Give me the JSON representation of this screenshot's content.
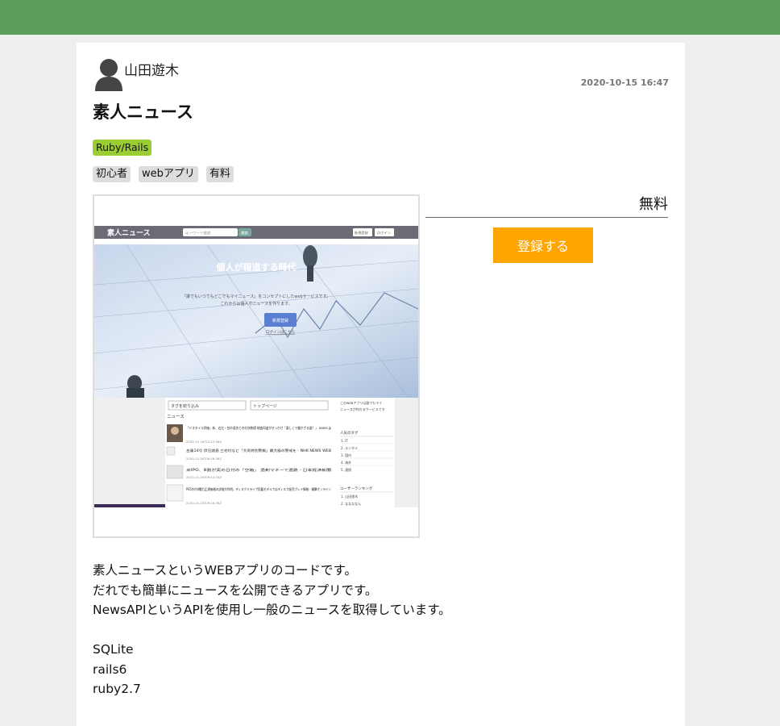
{
  "post": {
    "author": "山田遊木",
    "date": "2020-10-15 16:47",
    "title": "素人ニュース",
    "category": "Ruby/Rails",
    "tags": [
      "初心者",
      "webアプリ",
      "有料"
    ],
    "price": "無料",
    "register_label": "登録する",
    "description": [
      "素人ニュースというWEBアプリのコードです。",
      "だれでも簡単にニュースを公開できるアプリです。",
      "NewsAPIというAPIを使用し一般のニュースを取得しています。"
    ],
    "tech": [
      "SQLite",
      "rails6",
      "ruby2.7"
    ]
  },
  "screenshot": {
    "site_name": "素人ニュース",
    "search_placeholder": "キーワード検索",
    "search_button": "検索",
    "signup": "新規登録",
    "login": "ログイン",
    "hero_title": "個人が報道する時代",
    "hero_text_1": "「誰でもいつでもどこでもマイニュース」をコンセプトにしたwebサービスです。",
    "hero_text_2": "これからは個人でニュースを作ります。",
    "hero_button": "新規登録",
    "hero_link": "ログインはこちら",
    "tag_select": "タグを絞り込み",
    "page_select": "トップページ",
    "news_label": "ニュース",
    "news_items": [
      {
        "title": "「ドスタイル評価」新、右左・芸の混合との対決数値 検査同盗がきっかけ「楽しくて働かざる誰？」 asone.jp",
        "date": "2020-10-16T12:13:36Z"
      },
      {
        "title": "台風14号 伊豆諸島 三宅村など「大雨特別警報」最大級の警戒を - NHK NEWS WEB",
        "date": "2020-10-16T06:16:36Z"
      },
      {
        "title": "米IPO、8割が実の日付の「空箱」 過剰マネーで過熱 - 日本経済新聞",
        "date": "2020-10-16T09:14:16Z"
      },
      {
        "title": "PS5の内4種力正規価格の詳細が判明。ディスクドライブ搭載モデルではディスク販売ブレイ情報 - 電撃オンライン",
        "date": "2020-10-16T09:16:36Z"
      }
    ],
    "side_text_1": "このwebアプリは誰でもマイ",
    "side_text_2": "ニュースが作れるサービスです",
    "popular_tags": "人気のタグ",
    "tag_list": [
      "1. IT",
      "2. エンタメ",
      "3. 国内",
      "4. 海外",
      "5. 連続"
    ],
    "ranking_label": "ユーザーランキング",
    "ranking_list": [
      "1. 山田遊木",
      "2. ななななん"
    ]
  }
}
